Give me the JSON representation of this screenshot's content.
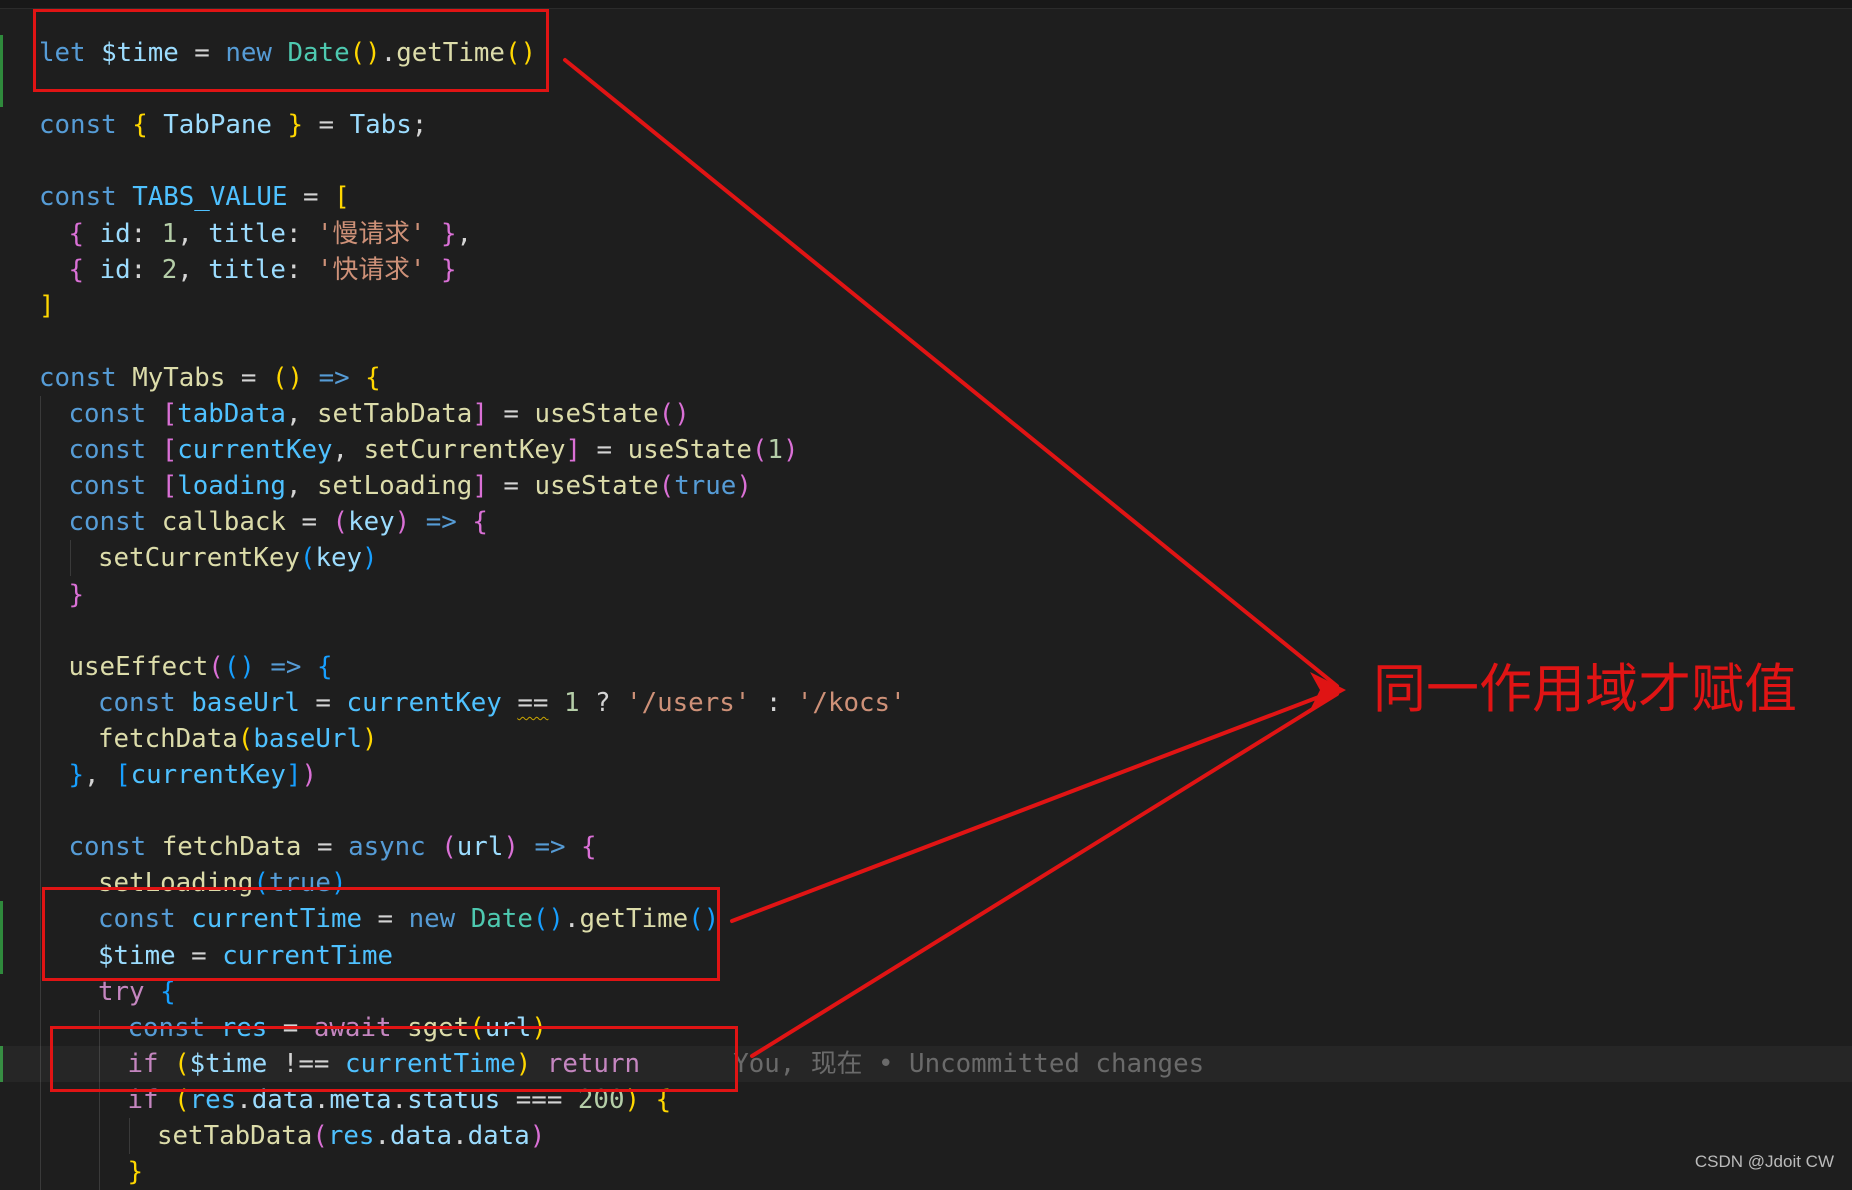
{
  "colors": {
    "background": "#1e1e1e",
    "annotation": "#e01414",
    "keyword": "#569cd6",
    "control": "#c586c0",
    "class": "#4ec9b0",
    "function": "#dcdcaa",
    "variable": "#9cdcfe",
    "constant": "#4fc1ff",
    "string": "#ce9178",
    "number": "#b5cea8",
    "bracket_1": "#ffd700",
    "bracket_2": "#da70d6",
    "bracket_3": "#179fff",
    "blame": "#6a6a6a"
  },
  "editor": {
    "lines": [
      {
        "indent": 0,
        "tokens": [
          [
            "let ",
            "kw"
          ],
          [
            "$time",
            "var"
          ],
          [
            " = ",
            "op"
          ],
          [
            "new ",
            "kw"
          ],
          [
            "Date",
            "cls"
          ],
          [
            "()",
            "b1"
          ],
          [
            ".",
            "op"
          ],
          [
            "getTime",
            "fn"
          ],
          [
            "()",
            "b1"
          ]
        ]
      },
      {
        "indent": 0,
        "tokens": []
      },
      {
        "indent": 0,
        "tokens": [
          [
            "const ",
            "kw"
          ],
          [
            "{",
            "b1"
          ],
          [
            " ",
            "op"
          ],
          [
            "TabPane",
            "var"
          ],
          [
            " ",
            "op"
          ],
          [
            "}",
            "b1"
          ],
          [
            " = ",
            "op"
          ],
          [
            "Tabs",
            "var"
          ],
          [
            ";",
            "op"
          ]
        ]
      },
      {
        "indent": 0,
        "tokens": []
      },
      {
        "indent": 0,
        "tokens": [
          [
            "const ",
            "kw"
          ],
          [
            "TABS_VALUE",
            "const"
          ],
          [
            " = ",
            "op"
          ],
          [
            "[",
            "b1"
          ]
        ]
      },
      {
        "indent": 1,
        "tokens": [
          [
            "{",
            "b2"
          ],
          [
            " ",
            "op"
          ],
          [
            "id",
            "var"
          ],
          [
            ": ",
            "op"
          ],
          [
            "1",
            "num"
          ],
          [
            ", ",
            "op"
          ],
          [
            "title",
            "var"
          ],
          [
            ": ",
            "op"
          ],
          [
            "'慢请求'",
            "str"
          ],
          [
            " ",
            "op"
          ],
          [
            "}",
            "b2"
          ],
          [
            ",",
            "op"
          ]
        ]
      },
      {
        "indent": 1,
        "tokens": [
          [
            "{",
            "b2"
          ],
          [
            " ",
            "op"
          ],
          [
            "id",
            "var"
          ],
          [
            ": ",
            "op"
          ],
          [
            "2",
            "num"
          ],
          [
            ", ",
            "op"
          ],
          [
            "title",
            "var"
          ],
          [
            ": ",
            "op"
          ],
          [
            "'快请求'",
            "str"
          ],
          [
            " ",
            "op"
          ],
          [
            "}",
            "b2"
          ]
        ]
      },
      {
        "indent": 0,
        "tokens": [
          [
            "]",
            "b1"
          ]
        ]
      },
      {
        "indent": 0,
        "tokens": []
      },
      {
        "indent": 0,
        "tokens": [
          [
            "const ",
            "kw"
          ],
          [
            "MyTabs",
            "fn"
          ],
          [
            " = ",
            "op"
          ],
          [
            "()",
            "b1"
          ],
          [
            " ",
            "op"
          ],
          [
            "=>",
            "kw"
          ],
          [
            " ",
            "op"
          ],
          [
            "{",
            "b1"
          ]
        ]
      },
      {
        "indent": 1,
        "tokens": [
          [
            "const ",
            "kw"
          ],
          [
            "[",
            "b2"
          ],
          [
            "tabData",
            "const"
          ],
          [
            ", ",
            "op"
          ],
          [
            "setTabData",
            "fn"
          ],
          [
            "]",
            "b2"
          ],
          [
            " = ",
            "op"
          ],
          [
            "useState",
            "fn"
          ],
          [
            "()",
            "b2"
          ]
        ]
      },
      {
        "indent": 1,
        "tokens": [
          [
            "const ",
            "kw"
          ],
          [
            "[",
            "b2"
          ],
          [
            "currentKey",
            "const"
          ],
          [
            ", ",
            "op"
          ],
          [
            "setCurrentKey",
            "fn"
          ],
          [
            "]",
            "b2"
          ],
          [
            " = ",
            "op"
          ],
          [
            "useState",
            "fn"
          ],
          [
            "(",
            "b2"
          ],
          [
            "1",
            "num"
          ],
          [
            ")",
            "b2"
          ]
        ]
      },
      {
        "indent": 1,
        "tokens": [
          [
            "const ",
            "kw"
          ],
          [
            "[",
            "b2"
          ],
          [
            "loading",
            "const"
          ],
          [
            ", ",
            "op"
          ],
          [
            "setLoading",
            "fn"
          ],
          [
            "]",
            "b2"
          ],
          [
            " = ",
            "op"
          ],
          [
            "useState",
            "fn"
          ],
          [
            "(",
            "b2"
          ],
          [
            "true",
            "kw"
          ],
          [
            ")",
            "b2"
          ]
        ]
      },
      {
        "indent": 1,
        "tokens": [
          [
            "const ",
            "kw"
          ],
          [
            "callback",
            "fn"
          ],
          [
            " = ",
            "op"
          ],
          [
            "(",
            "b2"
          ],
          [
            "key",
            "var"
          ],
          [
            ")",
            "b2"
          ],
          [
            " ",
            "op"
          ],
          [
            "=>",
            "kw"
          ],
          [
            " ",
            "op"
          ],
          [
            "{",
            "b2"
          ]
        ]
      },
      {
        "indent": 2,
        "tokens": [
          [
            "setCurrentKey",
            "fn"
          ],
          [
            "(",
            "b3"
          ],
          [
            "key",
            "var"
          ],
          [
            ")",
            "b3"
          ]
        ]
      },
      {
        "indent": 1,
        "tokens": [
          [
            "}",
            "b2"
          ]
        ]
      },
      {
        "indent": 0,
        "tokens": []
      },
      {
        "indent": 1,
        "tokens": [
          [
            "useEffect",
            "fn"
          ],
          [
            "(",
            "b2"
          ],
          [
            "()",
            "b3"
          ],
          [
            " ",
            "op"
          ],
          [
            "=>",
            "kw"
          ],
          [
            " ",
            "op"
          ],
          [
            "{",
            "b3"
          ]
        ]
      },
      {
        "indent": 2,
        "tokens": [
          [
            "const ",
            "kw"
          ],
          [
            "baseUrl",
            "const"
          ],
          [
            " = ",
            "op"
          ],
          [
            "currentKey",
            "const"
          ],
          [
            " ",
            "op"
          ],
          [
            "==",
            "squig"
          ],
          [
            " ",
            "op"
          ],
          [
            "1",
            "num"
          ],
          [
            " ? ",
            "op"
          ],
          [
            "'/users'",
            "str"
          ],
          [
            " : ",
            "op"
          ],
          [
            "'/kocs'",
            "str"
          ]
        ]
      },
      {
        "indent": 2,
        "tokens": [
          [
            "fetchData",
            "fn"
          ],
          [
            "(",
            "b1"
          ],
          [
            "baseUrl",
            "const"
          ],
          [
            ")",
            "b1"
          ]
        ]
      },
      {
        "indent": 1,
        "tokens": [
          [
            "}",
            "b3"
          ],
          [
            ", ",
            "op"
          ],
          [
            "[",
            "b3"
          ],
          [
            "currentKey",
            "const"
          ],
          [
            "]",
            "b3"
          ],
          [
            ")",
            "b2"
          ]
        ]
      },
      {
        "indent": 0,
        "tokens": []
      },
      {
        "indent": 1,
        "tokens": [
          [
            "const ",
            "kw"
          ],
          [
            "fetchData",
            "fn"
          ],
          [
            " = ",
            "op"
          ],
          [
            "async ",
            "kw"
          ],
          [
            "(",
            "b2"
          ],
          [
            "url",
            "var"
          ],
          [
            ")",
            "b2"
          ],
          [
            " ",
            "op"
          ],
          [
            "=>",
            "kw"
          ],
          [
            " ",
            "op"
          ],
          [
            "{",
            "b2"
          ]
        ]
      },
      {
        "indent": 2,
        "tokens": [
          [
            "setLoading",
            "fn"
          ],
          [
            "(",
            "b3"
          ],
          [
            "true",
            "kw"
          ],
          [
            ")",
            "b3"
          ]
        ]
      },
      {
        "indent": 2,
        "tokens": [
          [
            "const ",
            "kw"
          ],
          [
            "currentTime",
            "const"
          ],
          [
            " = ",
            "op"
          ],
          [
            "new ",
            "kw"
          ],
          [
            "Date",
            "cls"
          ],
          [
            "()",
            "b3"
          ],
          [
            ".",
            "op"
          ],
          [
            "getTime",
            "fn"
          ],
          [
            "()",
            "b3"
          ]
        ]
      },
      {
        "indent": 2,
        "tokens": [
          [
            "$time",
            "var"
          ],
          [
            " = ",
            "op"
          ],
          [
            "currentTime",
            "const"
          ]
        ]
      },
      {
        "indent": 2,
        "tokens": [
          [
            "try ",
            "ctl"
          ],
          [
            "{",
            "b3"
          ]
        ]
      },
      {
        "indent": 3,
        "tokens": [
          [
            "const ",
            "kw"
          ],
          [
            "res",
            "const"
          ],
          [
            " = ",
            "op"
          ],
          [
            "await ",
            "ctl"
          ],
          [
            "sget",
            "fn"
          ],
          [
            "(",
            "b1"
          ],
          [
            "url",
            "var"
          ],
          [
            ")",
            "b1"
          ]
        ]
      },
      {
        "indent": 3,
        "tokens": [
          [
            "if ",
            "ctl"
          ],
          [
            "(",
            "b1"
          ],
          [
            "$time",
            "var"
          ],
          [
            " !== ",
            "op"
          ],
          [
            "currentTime",
            "const"
          ],
          [
            ")",
            "b1"
          ],
          [
            " ",
            "op"
          ],
          [
            "return",
            "ctl"
          ],
          [
            "      You, 现在 • Uncommitted changes",
            "blame"
          ]
        ]
      },
      {
        "indent": 3,
        "tokens": [
          [
            "if ",
            "ctl"
          ],
          [
            "(",
            "b1"
          ],
          [
            "res",
            "const"
          ],
          [
            ".",
            "op"
          ],
          [
            "data",
            "var"
          ],
          [
            ".",
            "op"
          ],
          [
            "meta",
            "var"
          ],
          [
            ".",
            "op"
          ],
          [
            "status",
            "var"
          ],
          [
            " === ",
            "op"
          ],
          [
            "200",
            "num"
          ],
          [
            ")",
            "b1"
          ],
          [
            " ",
            "op"
          ],
          [
            "{",
            "b1"
          ]
        ]
      },
      {
        "indent": 4,
        "tokens": [
          [
            "setTabData",
            "fn"
          ],
          [
            "(",
            "b2"
          ],
          [
            "res",
            "const"
          ],
          [
            ".",
            "op"
          ],
          [
            "data",
            "var"
          ],
          [
            ".",
            "op"
          ],
          [
            "data",
            "var"
          ],
          [
            ")",
            "b2"
          ]
        ]
      },
      {
        "indent": 3,
        "tokens": [
          [
            "}",
            "b1"
          ]
        ]
      }
    ]
  },
  "annotation": {
    "label": "同一作用域才赋值"
  },
  "watermark": "CSDN @Jdoit CW"
}
